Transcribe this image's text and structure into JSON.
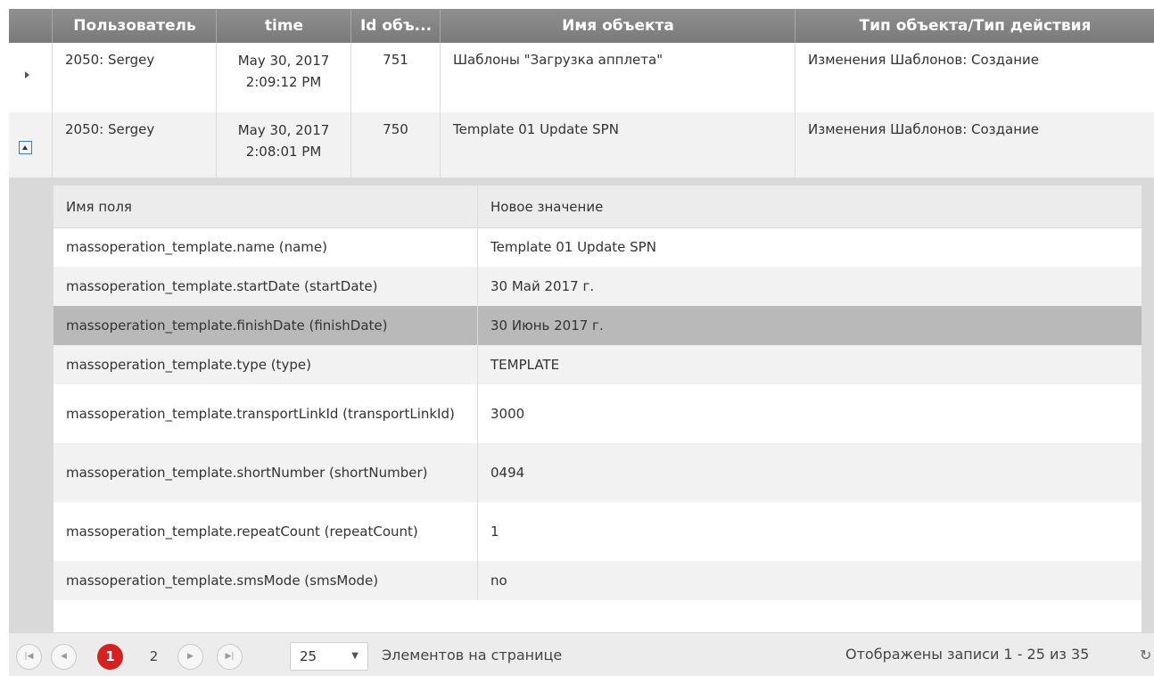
{
  "columns": {
    "user": "Пользователь",
    "time": "time",
    "id": "Id объ...",
    "name": "Имя объекта",
    "type": "Тип объекта/Тип действия"
  },
  "rows": [
    {
      "user": "2050: Sergey",
      "time_date": "May 30, 2017",
      "time_clock": "2:09:12 PM",
      "id": "751",
      "name": "Шаблоны \"Загрузка апплета\"",
      "type": "Изменения Шаблонов: Создание",
      "expanded": false
    },
    {
      "user": "2050: Sergey",
      "time_date": "May 30, 2017",
      "time_clock": "2:08:01 PM",
      "id": "750",
      "name": "Template 01 Update SPN",
      "type": "Изменения Шаблонов: Создание",
      "expanded": true
    }
  ],
  "detail": {
    "col_field": "Имя поля",
    "col_value": "Новое значение",
    "rows": [
      {
        "field": "massoperation_template.name (name)",
        "value": "Template 01 Update SPN"
      },
      {
        "field": "massoperation_template.startDate (startDate)",
        "value": "30 Май 2017 г."
      },
      {
        "field": "massoperation_template.finishDate (finishDate)",
        "value": "30 Июнь 2017 г.",
        "selected": true
      },
      {
        "field": "massoperation_template.type (type)",
        "value": "TEMPLATE"
      },
      {
        "field": "massoperation_template.transportLinkId (transportLinkId)",
        "value": "3000"
      },
      {
        "field": "massoperation_template.shortNumber (shortNumber)",
        "value": "0494"
      },
      {
        "field": "massoperation_template.repeatCount (repeatCount)",
        "value": "1"
      },
      {
        "field": "massoperation_template.smsMode (smsMode)",
        "value": "no"
      }
    ]
  },
  "pager": {
    "pages": [
      "1",
      "2"
    ],
    "current_page": "1",
    "page_size": "25",
    "page_size_label": "Элементов на странице",
    "info": "Отображены записи 1 - 25 из 35",
    "refresh_glyph": "↻"
  }
}
